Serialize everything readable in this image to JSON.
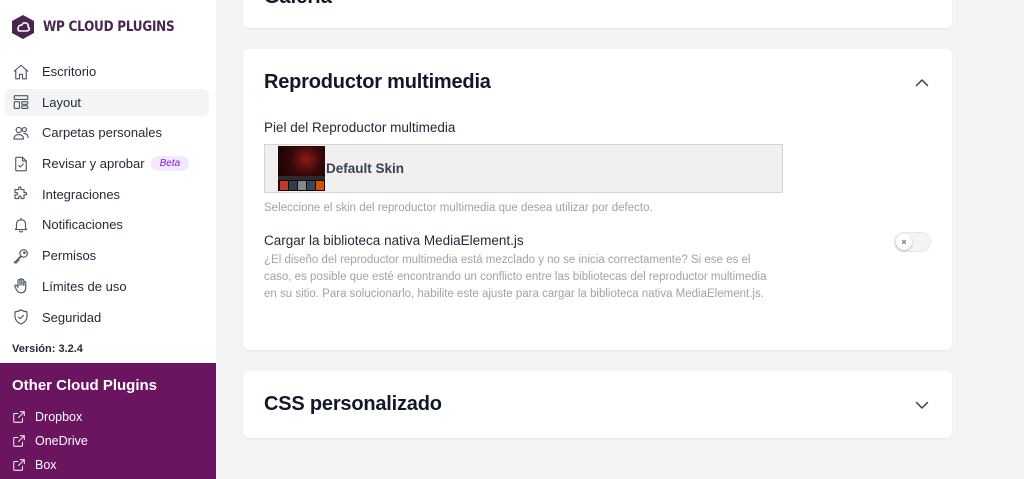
{
  "brand": {
    "name": "WP CLOUD PLUGINS",
    "color": "#4a2550"
  },
  "nav": {
    "items": [
      {
        "label": "Escritorio",
        "icon": "home-icon"
      },
      {
        "label": "Layout",
        "icon": "layout-icon",
        "active": true
      },
      {
        "label": "Carpetas personales",
        "icon": "users-icon"
      },
      {
        "label": "Revisar y aprobar",
        "icon": "document-check-icon",
        "badge": "Beta"
      },
      {
        "label": "Integraciones",
        "icon": "puzzle-icon"
      },
      {
        "label": "Notificaciones",
        "icon": "bell-icon"
      },
      {
        "label": "Permisos",
        "icon": "key-icon"
      },
      {
        "label": "Límites de uso",
        "icon": "hand-icon"
      },
      {
        "label": "Seguridad",
        "icon": "shield-check-icon"
      }
    ]
  },
  "version": "Versión: 3.2.4",
  "other_plugins": {
    "title": "Other Cloud Plugins",
    "bg_color": "#6b1561",
    "items": [
      {
        "label": "Dropbox",
        "icon": "external-link-icon"
      },
      {
        "label": "OneDrive",
        "icon": "external-link-icon"
      },
      {
        "label": "Box",
        "icon": "external-link-icon"
      }
    ]
  },
  "cards": {
    "top_clipped_title": "Galería",
    "media": {
      "title": "Reproductor multimedia",
      "expanded": true,
      "skin_label": "Piel del Reproductor multimedia",
      "skin_value": "Default Skin",
      "skin_help": "Seleccione el skin del reproductor multimedia que desea utilizar por defecto.",
      "native_label": "Cargar la biblioteca nativa MediaElement.js",
      "native_desc": "¿El diseño del reproductor multimedia está mezclado y no se inicia correctamente? Si ese es el caso, es posible que esté encontrando un conflicto entre las bibliotecas del reproductor multimedia en su sitio. Para solucionarlo, habilite este ajuste para cargar la biblioteca nativa MediaElement.js.",
      "native_enabled": false,
      "toggle_glyph": "×"
    },
    "css": {
      "title": "CSS personalizado",
      "expanded": false
    }
  }
}
